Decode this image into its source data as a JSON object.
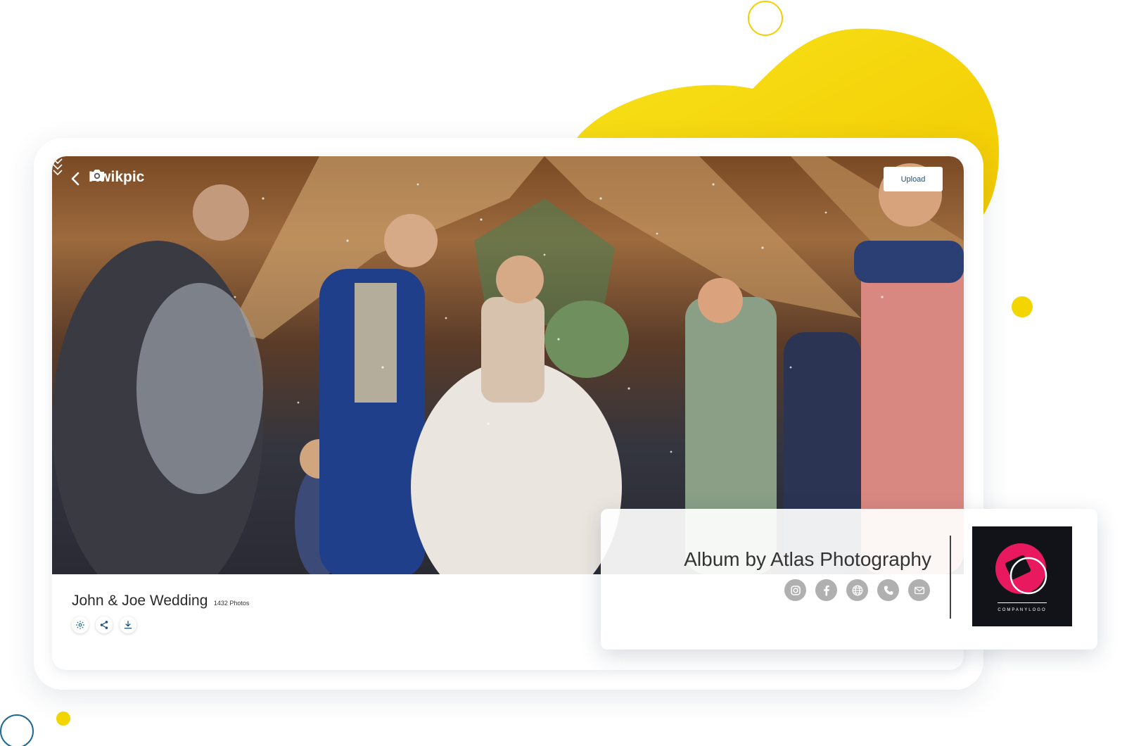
{
  "app": {
    "name": "Kwikpic"
  },
  "header": {
    "upload_label": "Upload"
  },
  "album": {
    "title": "John & Joe Wedding",
    "photo_count": "1432 Photos"
  },
  "photographer": {
    "card_title": "Album by Atlas Photography",
    "socials": [
      "instagram-icon",
      "facebook-icon",
      "globe-icon",
      "phone-icon",
      "email-icon"
    ],
    "logo_text": "COMPANYLOGO"
  },
  "colors": {
    "accent_yellow": "#f3d500",
    "brand_blue": "#1e4d77",
    "logo_pink": "#e8195e"
  }
}
